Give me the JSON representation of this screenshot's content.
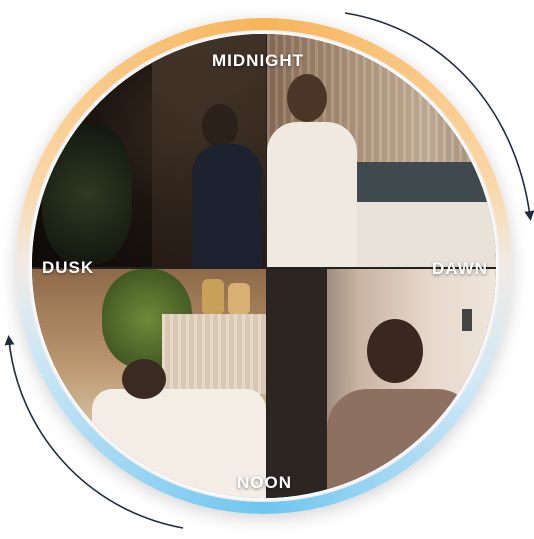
{
  "labels": {
    "midnight": "MIDNIGHT",
    "dawn": "DAWN",
    "noon": "NOON",
    "dusk": "DUSK"
  },
  "colors": {
    "ring_warm": "#f7b55a",
    "ring_cool": "#6ec6ef",
    "arrow": "#1f2a44"
  },
  "icons": [
    "clockwise-arrow-icon",
    "clockwise-arrow-icon"
  ]
}
